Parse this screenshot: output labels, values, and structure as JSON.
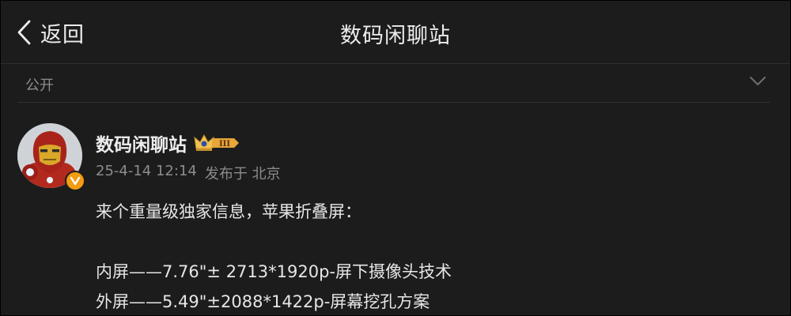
{
  "header": {
    "back_label": "返回",
    "title": "数码闲聊站"
  },
  "visibility": {
    "label": "公开"
  },
  "post": {
    "author": "数码闲聊站",
    "member_level": "III",
    "date": "25-4-14 12:14",
    "source": "发布于 北京",
    "lines": [
      "来个重量级独家信息，苹果折叠屏：",
      "",
      "内屏——7.76\"± 2713*1920p-屏下摄像头技术",
      "外屏——5.49\"±2088*1422p-屏幕挖孔方案"
    ]
  },
  "colors": {
    "background": "#1c1c1c",
    "text_primary": "#ececec",
    "text_secondary": "#8c8c8c",
    "badge_gold": "#f39c12"
  }
}
